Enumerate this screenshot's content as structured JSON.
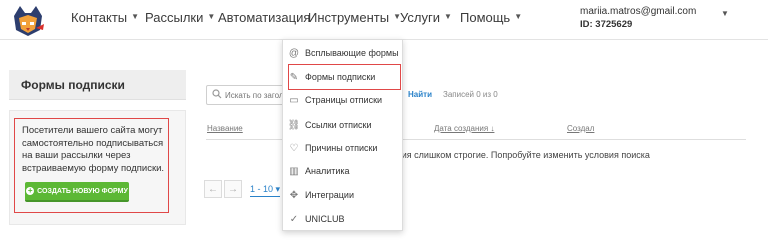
{
  "nav": {
    "items": [
      {
        "label": "Контакты",
        "caret": true
      },
      {
        "label": "Рассылки",
        "caret": true
      },
      {
        "label": "Автоматизация",
        "caret": false
      },
      {
        "label": "Инструменты",
        "caret": true
      },
      {
        "label": "Услуги",
        "caret": true
      },
      {
        "label": "Помощь",
        "caret": true
      }
    ],
    "caret_glyph": "▼"
  },
  "account": {
    "email": "mariia.matros@gmail.com",
    "id_label": "ID: 3725629"
  },
  "sidebar": {
    "title": "Формы подписки",
    "description": "Посетители вашего сайта могут самостоятельно подписываться на ваши рассылки через встраиваемую форму подписки.",
    "create_button": "СОЗДАТЬ НОВУЮ ФОРМУ"
  },
  "toolbar": {
    "search_placeholder": "Искать по заголовку",
    "find_label": "Найти",
    "records_label": "Записей 0 из 0"
  },
  "table": {
    "columns": [
      "Название",
      "Дата создания ↓",
      "Создал"
    ],
    "empty_message": "вия слишком строгие. Попробуйте изменить условия поиска"
  },
  "pager": {
    "prev": "←",
    "next": "→",
    "range": "1 - 10 ▾"
  },
  "dropdown": {
    "items": [
      {
        "label": "Всплывающие формы",
        "icon": "@",
        "icon_name": "at-icon"
      },
      {
        "label": "Формы подписки",
        "icon": "✎",
        "icon_name": "form-edit-icon"
      },
      {
        "label": "Страницы отписки",
        "icon": "▭",
        "icon_name": "page-icon"
      },
      {
        "label": "Ссылки отписки",
        "icon": "⛓",
        "icon_name": "link-icon"
      },
      {
        "label": "Причины отписки",
        "icon": "♡",
        "icon_name": "heart-icon"
      },
      {
        "label": "Аналитика",
        "icon": "▥",
        "icon_name": "analytics-icon"
      },
      {
        "label": "Интеграции",
        "icon": "✥",
        "icon_name": "integration-icon"
      },
      {
        "label": "UNICLUB",
        "icon": "✓",
        "icon_name": "check-icon"
      }
    ]
  },
  "colors": {
    "accent_green": "#5cb835",
    "link_blue": "#2a82c9",
    "highlight_red": "#e04848"
  }
}
